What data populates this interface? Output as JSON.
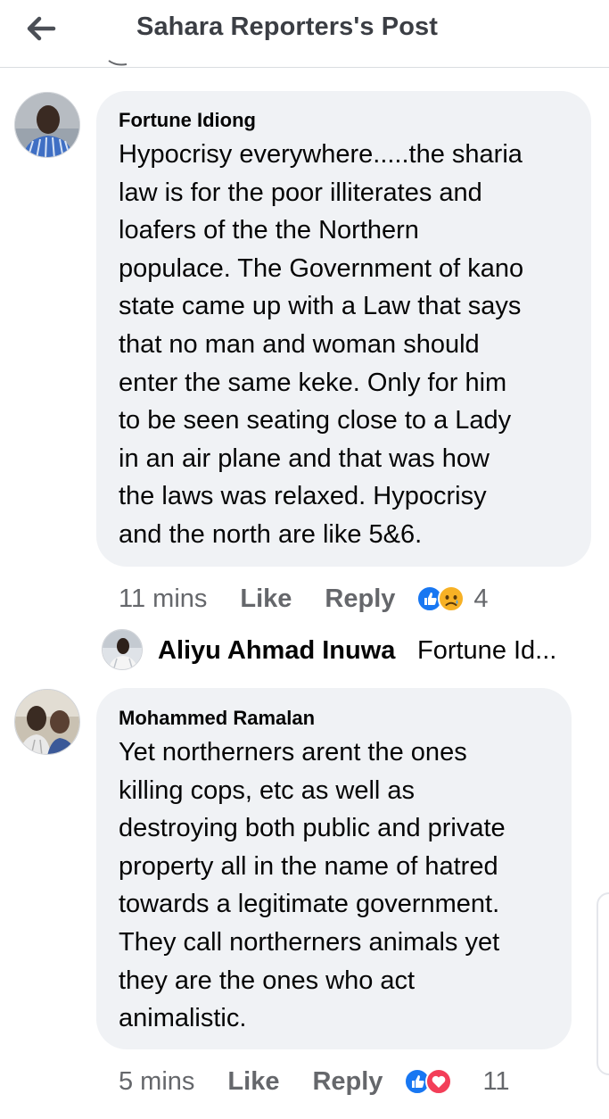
{
  "header": {
    "title": "Sahara Reporters's Post",
    "back_icon": "arrow-left-icon"
  },
  "comments": [
    {
      "author": "Fortune Idiong",
      "lines": [
        "Hypocrisy everywhere.....the sharia",
        "law is for the poor illiterates and",
        "loafers of the the Northern",
        "populace. The Government of kano",
        "state came up with a Law that says",
        "that no man and woman should",
        "enter the same keke. Only for him",
        "to be seen seating close to a Lady",
        "in an air plane and that was how",
        "the laws was relaxed. Hypocrisy",
        "and the north are like 5&6."
      ],
      "time": "11 mins",
      "like_label": "Like",
      "reply_label": "Reply",
      "reactions": [
        "like-icon",
        "sad-icon"
      ],
      "reaction_count": "4"
    },
    {
      "author": "Mohammed Ramalan",
      "lines": [
        "Yet northerners arent the ones",
        "killing cops, etc as well as",
        "destroying both public and private",
        "property all in the name of hatred",
        "towards a legitimate government.",
        "They call northerners animals yet",
        "they are the ones who act",
        "animalistic."
      ],
      "time": "5 mins",
      "like_label": "Like",
      "reply_label": "Reply",
      "reactions": [
        "like-icon",
        "love-icon"
      ],
      "reaction_count": "11"
    }
  ],
  "reply_preview": {
    "author": "Aliyu Ahmad Inuwa",
    "snippet": "Fortune Id..."
  },
  "colors": {
    "bubble": "#f0f2f5",
    "meta_text": "#65676b",
    "like_blue": "#1877f2",
    "love_red": "#f33e58",
    "sad_yellow": "#f7b125"
  }
}
